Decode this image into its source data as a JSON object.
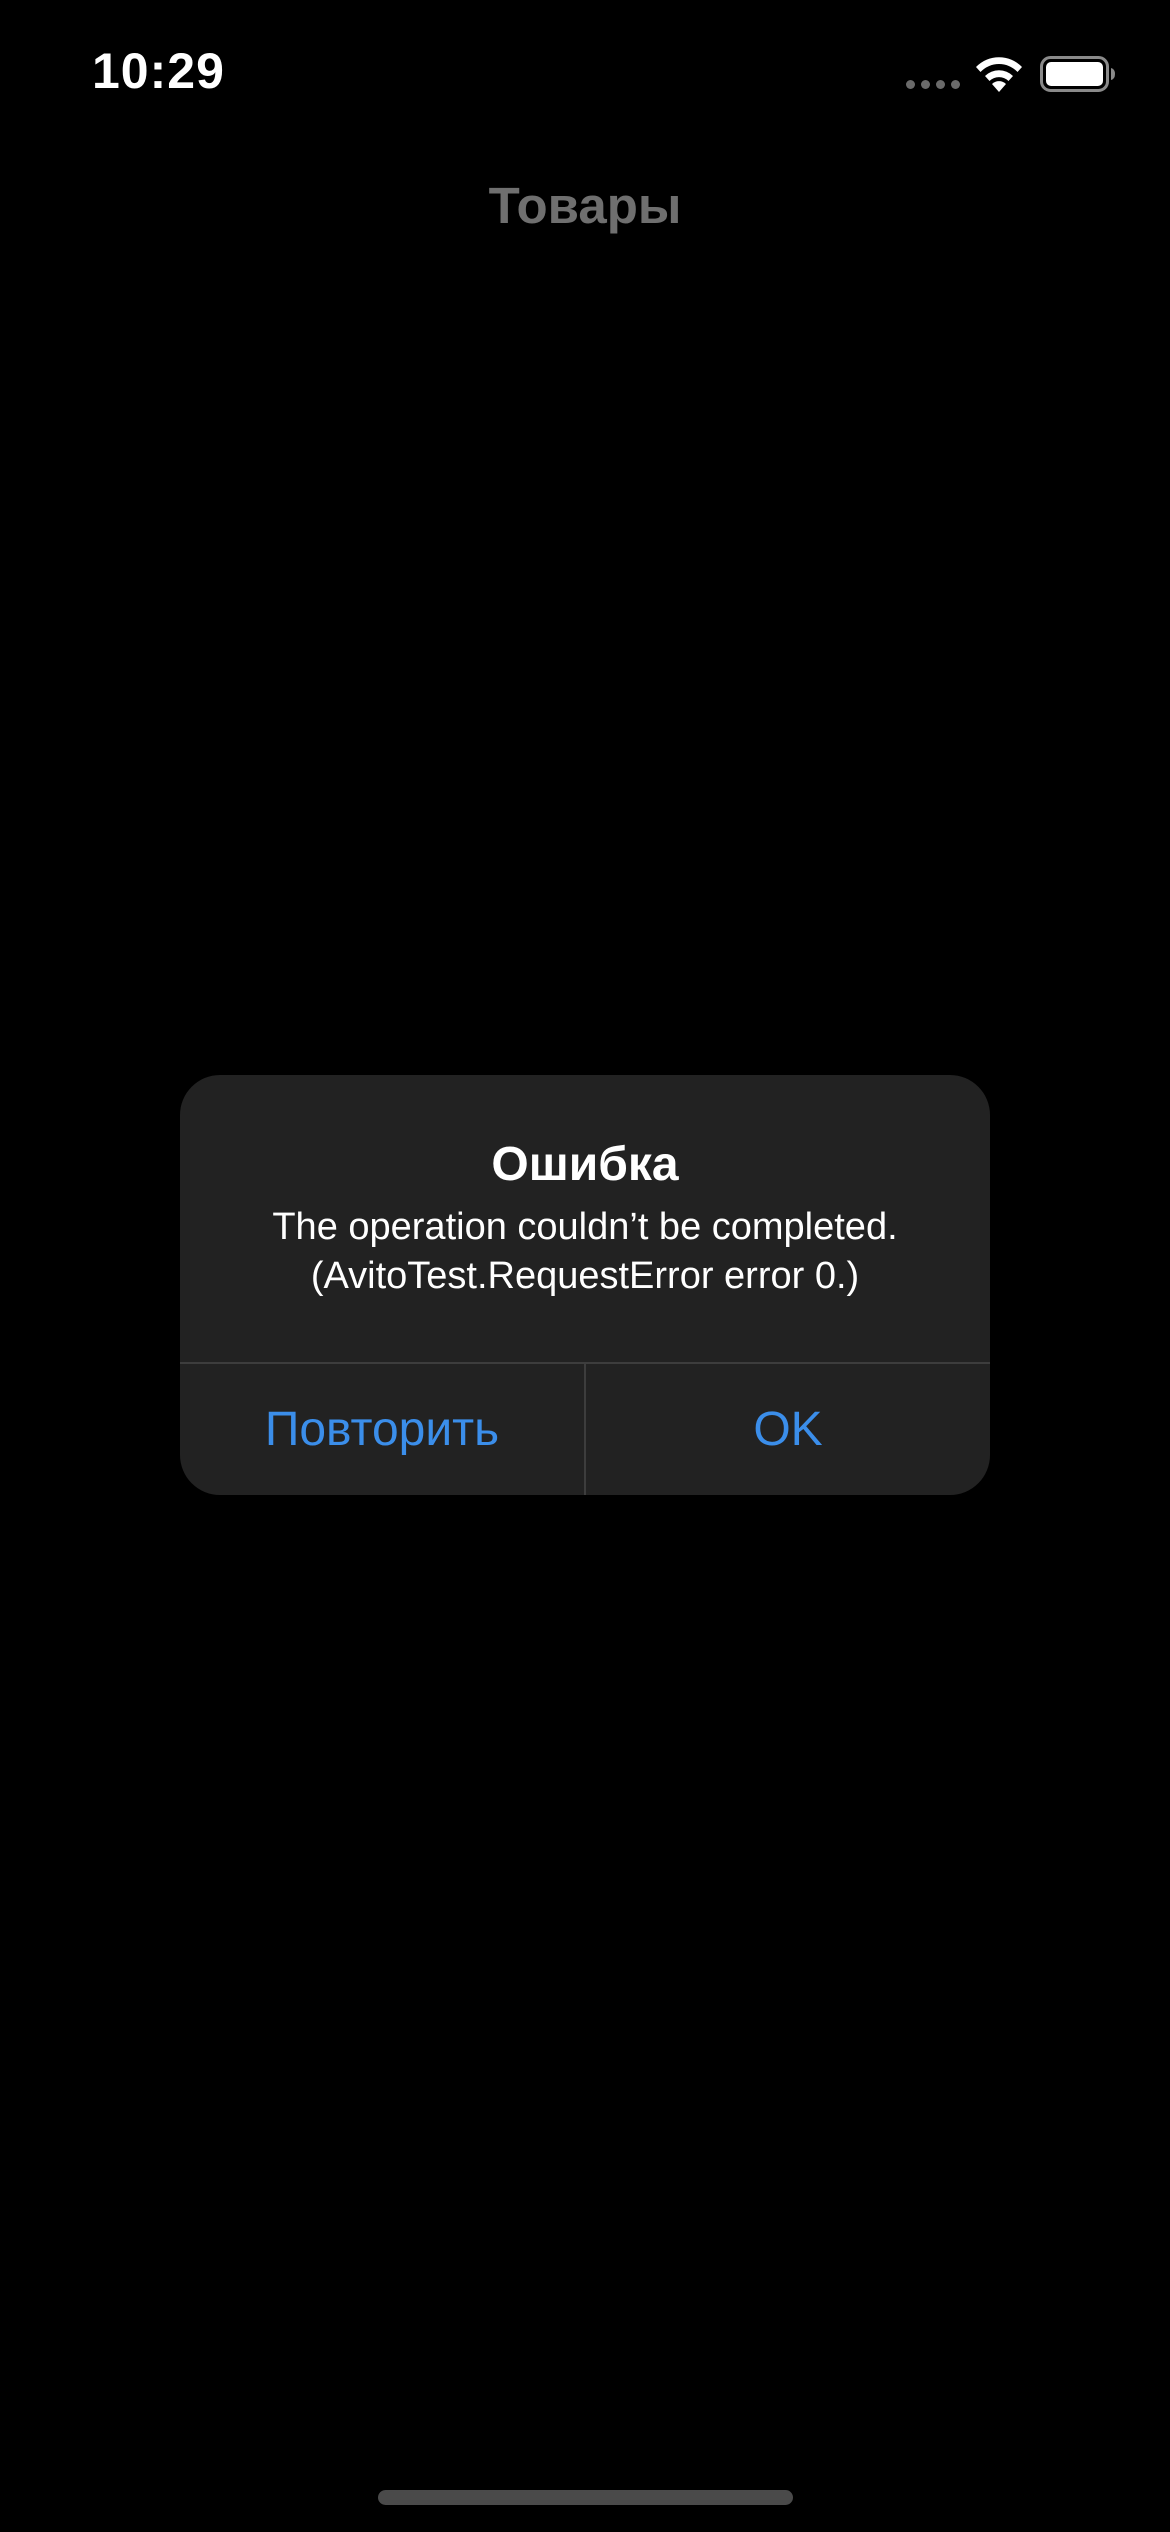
{
  "status_bar": {
    "time": "10:29",
    "icons": [
      "cellular-signal-icon",
      "wifi-icon",
      "battery-icon"
    ]
  },
  "nav": {
    "title": "Товары"
  },
  "alert": {
    "title": "Ошибка",
    "message_line1": "The operation couldn’t be completed.",
    "message_line2": "(AvitoTest.RequestError error 0.)",
    "buttons": [
      {
        "label": "Повторить"
      },
      {
        "label": "OK"
      }
    ]
  },
  "colors": {
    "background": "#000000",
    "alert_background": "#222222",
    "button_text": "#3b8eea",
    "nav_title": "#6f6f6f"
  }
}
